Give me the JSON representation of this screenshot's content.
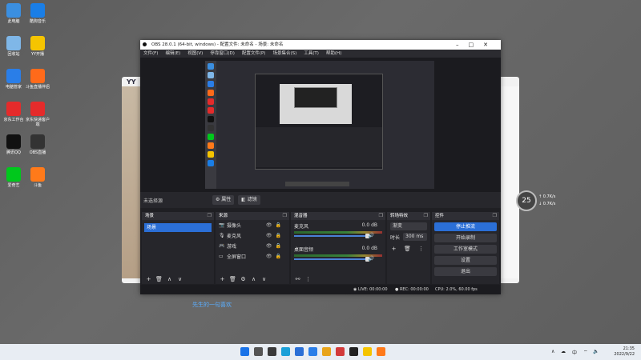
{
  "desktop": {
    "icons": [
      {
        "label": "此电脑",
        "color": "#3b8fe0"
      },
      {
        "label": "酷狗音乐",
        "color": "#1a7ee6"
      },
      {
        "label": "回收站",
        "color": "#7fb7e8"
      },
      {
        "label": "YY开播",
        "color": "#f5c400"
      },
      {
        "label": "电脑管家",
        "color": "#2a7ee8"
      },
      {
        "label": "斗鱼直播伴侣",
        "color": "#ff6a1a"
      },
      {
        "label": "京东工作台",
        "color": "#e52b2b"
      },
      {
        "label": "京东快递客户端",
        "color": "#e52b2b"
      },
      {
        "label": "腾讯QQ",
        "color": "#111111"
      },
      {
        "label": "OBS直播",
        "color": "#333333"
      },
      {
        "label": "爱奇艺",
        "color": "#00c81c"
      },
      {
        "label": "斗鱼",
        "color": "#ff7a1a"
      }
    ]
  },
  "yy_window": {
    "title": "YY"
  },
  "badge": {
    "value": "25",
    "up": "↑ 0.7K/s",
    "down": "↓ 0.7K/s"
  },
  "obs": {
    "title": "OBS 28.0.1 (64-bit, windows) - 配置文件: 未命名 - 场景: 未命名",
    "menu": [
      "文件(F)",
      "编辑(E)",
      "视图(V)",
      "停靠窗口(D)",
      "配置文件(P)",
      "场景集合(S)",
      "工具(T)",
      "帮助(H)"
    ],
    "context": {
      "label": "未选择源",
      "properties": "属性",
      "filters": "滤镜"
    },
    "scenes": {
      "header": "场景",
      "items": [
        "场景"
      ]
    },
    "sources": {
      "header": "来源",
      "items": [
        {
          "name": "摄像头",
          "icon": "camera-icon"
        },
        {
          "name": "麦克风",
          "icon": "microphone-icon"
        },
        {
          "name": "游戏",
          "icon": "gamepad-icon"
        },
        {
          "name": "全屏窗口",
          "icon": "monitor-icon"
        }
      ]
    },
    "mixer": {
      "header": "混音器",
      "channels": [
        {
          "name": "麦克风",
          "db": "0.0 dB"
        },
        {
          "name": "桌面音频",
          "db": "0.0 dB"
        }
      ]
    },
    "transitions": {
      "header": "转场特效",
      "type": "渐变",
      "duration_label": "时长",
      "duration": "300 ms"
    },
    "controls": {
      "header": "控件",
      "buttons": [
        "停止推流",
        "开始录制",
        "工作室模式",
        "设置",
        "退出"
      ]
    },
    "status": {
      "live": "LIVE: 00:00:00",
      "rec": "REC: 00:00:00",
      "cpu": "CPU: 2.0%, 60.00 fps"
    }
  },
  "caption": "先生的一句喜欢",
  "taskbar": {
    "apps": [
      {
        "name": "start-icon",
        "color": "#1a73e8"
      },
      {
        "name": "search-icon",
        "color": "#555555"
      },
      {
        "name": "taskview-icon",
        "color": "#3a3a3a"
      },
      {
        "name": "edge-icon",
        "color": "#1ba0d8"
      },
      {
        "name": "store-icon",
        "color": "#2a6fd6"
      },
      {
        "name": "security-icon",
        "color": "#2a7ee8"
      },
      {
        "name": "chrome-icon",
        "color": "#e8a41a"
      },
      {
        "name": "app-icon",
        "color": "#d23b3b"
      },
      {
        "name": "obs-icon",
        "color": "#222222"
      },
      {
        "name": "yy-icon",
        "color": "#f5c400"
      },
      {
        "name": "douyu-icon",
        "color": "#ff7a1a"
      }
    ],
    "lang": "中",
    "clock_time": "21:35",
    "clock_date": "2022/9/22"
  }
}
